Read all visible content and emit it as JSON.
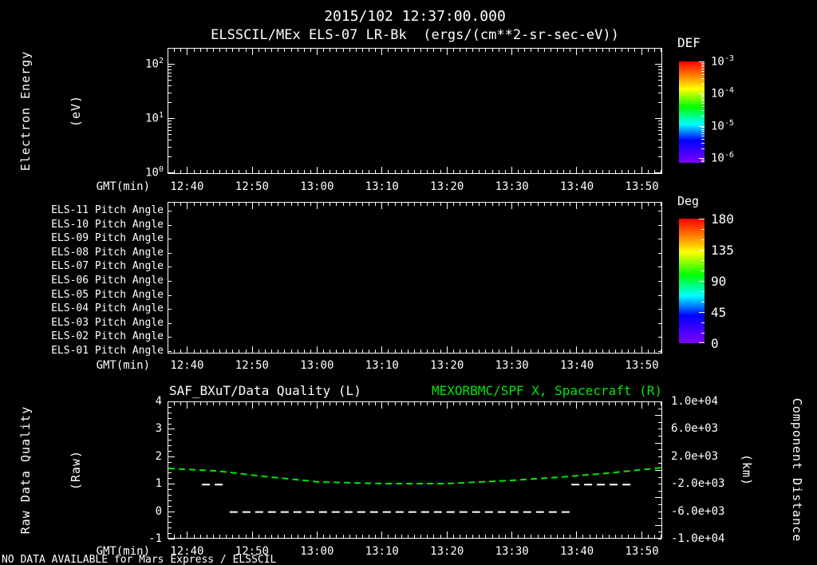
{
  "header": {
    "timestamp": "2015/102 12:37:00.000",
    "instrument_title": "ELSSCIL/MEx ELS-07 LR-Bk  (ergs/(cm**2-sr-sec-eV))"
  },
  "time_axis": {
    "label": "GMT(min)",
    "start": "12:37",
    "end": "13:53",
    "major_tick_labels": [
      "12:40",
      "12:50",
      "13:00",
      "13:10",
      "13:20",
      "13:30",
      "13:40",
      "13:50"
    ],
    "minor_tick_minutes": 1,
    "major_tick_minutes": 10
  },
  "panel_energy": {
    "ylabel_line1": "Electron Energy",
    "ylabel_line2": "(eV)",
    "ytick_exponents": [
      0,
      1,
      2
    ],
    "colorbar": {
      "label": "DEF",
      "tick_exponents": [
        -3,
        -4,
        -5,
        -6
      ],
      "decades_span": 3.15
    }
  },
  "panel_pitch": {
    "row_labels": [
      "ELS-11 Pitch Angle",
      "ELS-10 Pitch Angle",
      "ELS-09 Pitch Angle",
      "ELS-08 Pitch Angle",
      "ELS-07 Pitch Angle",
      "ELS-06 Pitch Angle",
      "ELS-05 Pitch Angle",
      "ELS-04 Pitch Angle",
      "ELS-03 Pitch Angle",
      "ELS-02 Pitch Angle",
      "ELS-01 Pitch Angle"
    ],
    "colorbar": {
      "label": "Deg",
      "ticks": [
        180,
        135,
        90,
        45,
        0
      ],
      "min": 0,
      "max": 180,
      "minor_step": 15
    }
  },
  "panel_line": {
    "title_left": "SAF_BXuT/Data Quality (L)",
    "title_right": "MEXORBMC/SPF X, Spacecraft (R)",
    "left_axis": {
      "label_line1": "Raw Data Quality",
      "label_line2": "(Raw)",
      "ticks": [
        4,
        3,
        2,
        1,
        0,
        -1
      ],
      "min": -1,
      "max": 4,
      "minor_step": 0.2
    },
    "right_axis": {
      "label_line1": "Component Distance",
      "label_line2": "(km)",
      "tick_labels": [
        "1.0e+04",
        "6.0e+03",
        "2.0e+03",
        "-2.0e+03",
        "-6.0e+03",
        "-1.0e+04"
      ],
      "tick_values": [
        10000,
        6000,
        2000,
        -2000,
        -6000,
        -10000
      ],
      "min": -10000,
      "max": 10000,
      "major_step": 4000,
      "minor_step": 1000
    }
  },
  "footer": {
    "no_data_message": "NO DATA AVAILABLE for Mars Express / ELSSCIL"
  },
  "colors": {
    "foreground": "#ffffff",
    "background": "#000000",
    "accent_green": "#00e60b"
  },
  "chart_data": [
    {
      "type": "heatmap",
      "title": "ELSSCIL/MEx ELS-07 LR-Bk electron energy spectrogram",
      "xlabel": "GMT(min)",
      "ylabel": "Electron Energy (eV)",
      "x_range": [
        "12:37",
        "13:53"
      ],
      "y_scale": "log",
      "y_range_ev": [
        1,
        200
      ],
      "value_units": "ergs/(cm**2-sr-sec-eV)",
      "colorbar": {
        "label": "DEF",
        "range": [
          1e-06,
          0.001
        ],
        "scale": "log"
      },
      "values": [],
      "note": "no data plotted (empty panel)"
    },
    {
      "type": "heatmap",
      "title": "ELS-01..ELS-11 pitch angle panels",
      "xlabel": "GMT(min)",
      "x_range": [
        "12:37",
        "13:53"
      ],
      "colorbar": {
        "label": "Deg",
        "range": [
          0,
          180
        ]
      },
      "values": [],
      "note": "no data plotted (empty panel)"
    },
    {
      "type": "line",
      "xlabel": "GMT(min)",
      "x_range": [
        "12:37",
        "13:53"
      ],
      "left_ylim": [
        -1,
        4
      ],
      "right_ylim": [
        -10000,
        10000
      ],
      "grid": false,
      "series": [
        {
          "name": "MEXORBMC/SPF X, Spacecraft (R)",
          "axis": "right",
          "units": "km",
          "style": "dashed",
          "color": "#00e60b",
          "points_x_frac": [
            0.0,
            0.097,
            0.194,
            0.307,
            0.436,
            0.565,
            0.695,
            0.792,
            0.888,
            1.0
          ],
          "points_km": [
            350,
            0,
            -810,
            -1630,
            -1860,
            -1860,
            -1400,
            -930,
            -350,
            460
          ]
        },
        {
          "name": "SAF_BXuT/Data Quality (L)",
          "axis": "left",
          "style": "dashed",
          "color": "#ffffff",
          "segments": [
            {
              "x0_frac": 0.068,
              "x1_frac": 0.118,
              "value": 1
            },
            {
              "x0_frac": 0.124,
              "x1_frac": 0.813,
              "value": 0
            },
            {
              "x0_frac": 0.816,
              "x1_frac": 0.937,
              "value": 1
            }
          ]
        }
      ]
    }
  ]
}
